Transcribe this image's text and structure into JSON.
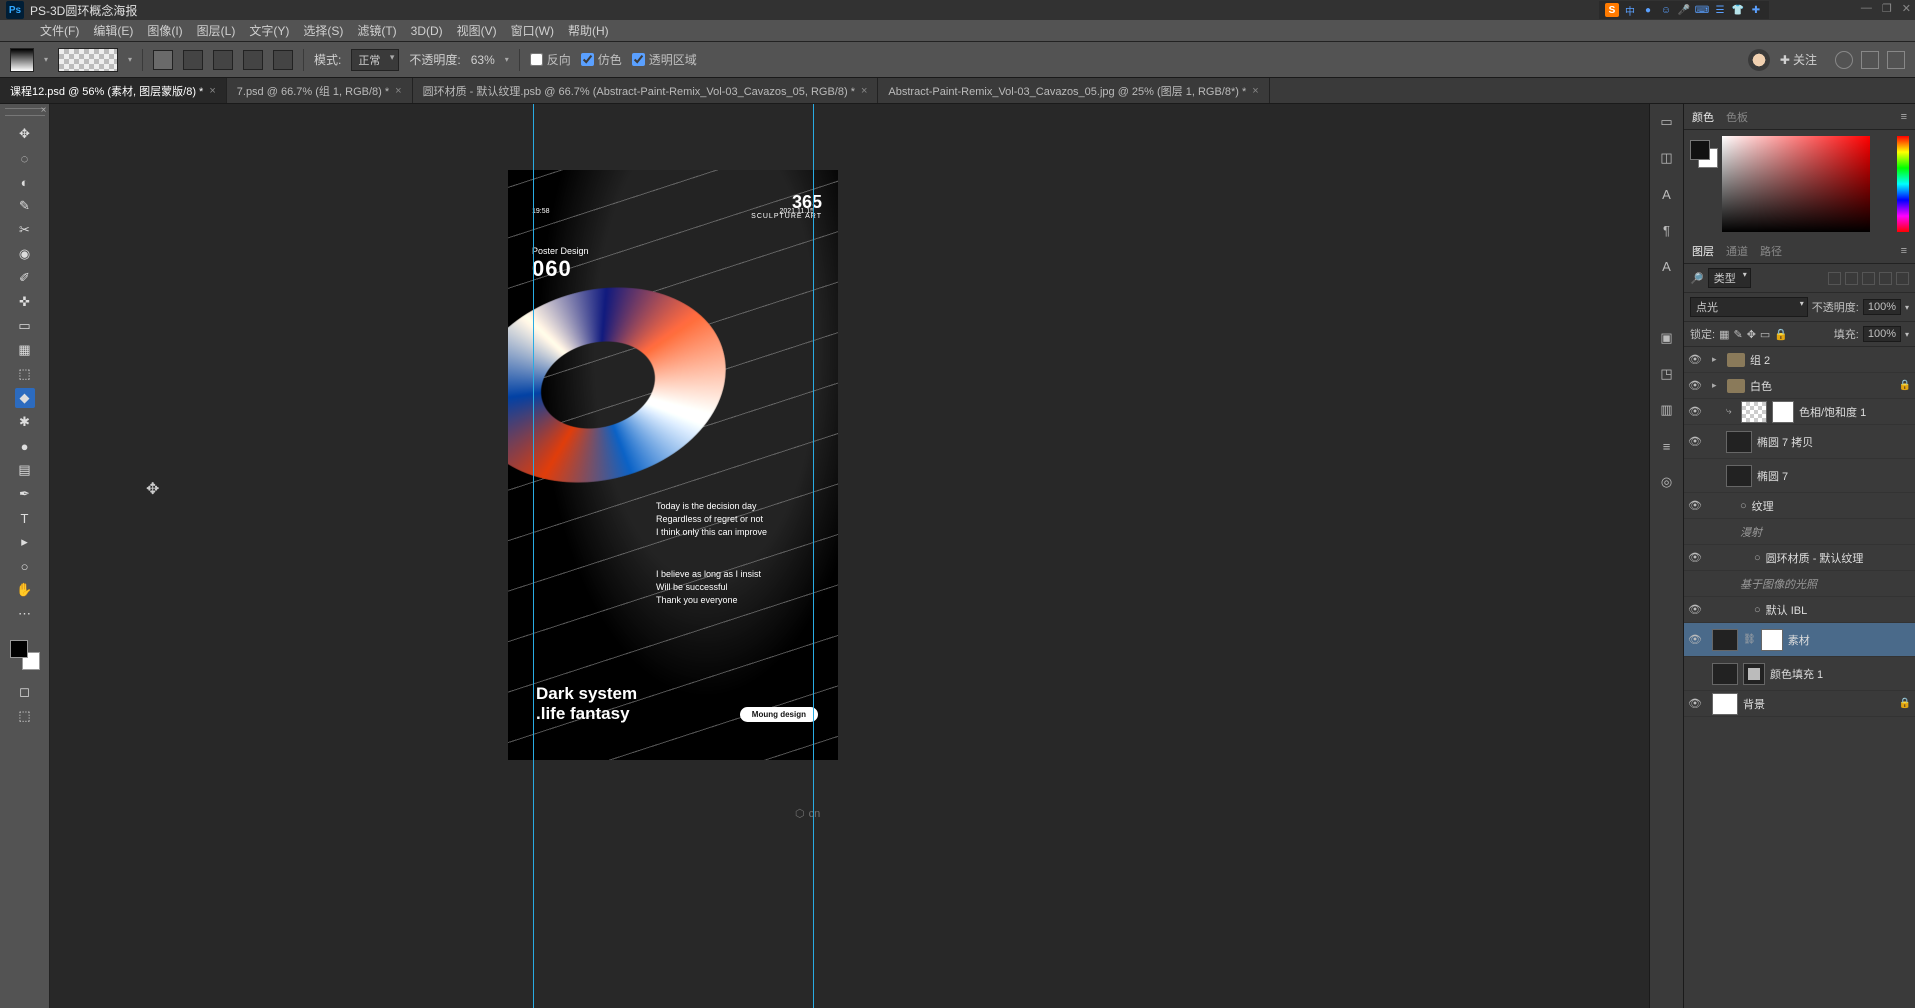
{
  "app": {
    "icon": "Ps",
    "title": "PS-3D圆环概念海报"
  },
  "win_ctrls": {
    "min": "—",
    "max": "❐",
    "close": "✕"
  },
  "indicators": [
    "中",
    "●",
    "☺",
    "🎤",
    "⌨",
    "☰",
    "👕",
    "✚"
  ],
  "menu": [
    "文件(F)",
    "编辑(E)",
    "图像(I)",
    "图层(L)",
    "文字(Y)",
    "选择(S)",
    "滤镜(T)",
    "3D(D)",
    "视图(V)",
    "窗口(W)",
    "帮助(H)"
  ],
  "opt": {
    "mode_label": "模式:",
    "mode_value": "正常",
    "opacity_label": "不透明度:",
    "opacity_value": "63%",
    "reverse": "反向",
    "dither": "仿色",
    "transparency": "透明区域",
    "follow": "关注"
  },
  "tabs": [
    {
      "label": "课程12.psd @ 56% (素材, 图层蒙版/8) *",
      "active": true
    },
    {
      "label": "7.psd @ 66.7% (组 1, RGB/8) *",
      "active": false
    },
    {
      "label": "圆环材质 - 默认纹理.psb @ 66.7% (Abstract-Paint-Remix_Vol-03_Cavazos_05, RGB/8) *",
      "active": false
    },
    {
      "label": "Abstract-Paint-Remix_Vol-03_Cavazos_05.jpg @ 25% (图层 1, RGB/8*) *",
      "active": false
    }
  ],
  "tools": [
    "✥",
    "◌",
    "◐",
    "✎",
    "✂",
    "◉",
    "✐",
    "✜",
    "▭",
    "▦",
    "⬚",
    "◆",
    "✱",
    "●",
    "▤",
    "✒",
    "T",
    "▸",
    "○",
    "✋",
    "🔍",
    "⋯"
  ],
  "mid_icons": [
    "▭",
    "◫",
    "A",
    "¶",
    "A",
    "▣",
    "◳",
    "▥",
    "≡",
    "◎"
  ],
  "color_panel": {
    "tabs": [
      "颜色",
      "色板"
    ]
  },
  "layers_panel": {
    "tabs": [
      "图层",
      "通道",
      "路径"
    ],
    "kind_label": "类型",
    "blend": "点光",
    "opacity_label": "不透明度:",
    "opacity_value": "100%",
    "lock_label": "锁定:",
    "fill_label": "填充:",
    "fill_value": "100%"
  },
  "layers": [
    {
      "eye": true,
      "indent": 0,
      "tw": "▸",
      "folder": true,
      "name": "组 2"
    },
    {
      "eye": true,
      "indent": 0,
      "tw": "▸",
      "folder": true,
      "name": "白色",
      "lock": true
    },
    {
      "eye": true,
      "indent": 1,
      "adjust": true,
      "name": "色相/饱和度 1"
    },
    {
      "eye": true,
      "indent": 1,
      "thumb": "img",
      "name": "椭圆 7 拷贝",
      "tall": true
    },
    {
      "eye": false,
      "indent": 1,
      "thumb": "img",
      "name": "椭圆 7",
      "tall": true
    },
    {
      "eye": true,
      "indent": 2,
      "sub": true,
      "name": "纹理"
    },
    {
      "eye": false,
      "indent": 2,
      "italic": true,
      "name": "漫射"
    },
    {
      "eye": true,
      "indent": 3,
      "sub": true,
      "name": "圆环材质 - 默认纹理"
    },
    {
      "eye": false,
      "indent": 2,
      "italic": true,
      "name": "基于图像的光照"
    },
    {
      "eye": true,
      "indent": 3,
      "sub": true,
      "name": "默认 IBL"
    },
    {
      "eye": true,
      "indent": 0,
      "thumb": "dark",
      "mask": true,
      "name": "素材",
      "selected": true,
      "tall": true
    },
    {
      "eye": false,
      "indent": 0,
      "thumb": "dark",
      "mask": "shape",
      "name": "颜色填充 1",
      "tall": true
    },
    {
      "eye": true,
      "indent": 0,
      "thumb": "white",
      "name": "背景",
      "lock": true
    }
  ],
  "poster": {
    "tl_small": "Poster Design",
    "tl_big": "060",
    "top_time": "19:58",
    "top_date": "2021.11.15",
    "tr_big": "365",
    "tr_small": "SCULPTURE ART",
    "p1_l1": "Today is the decision day",
    "p1_l2": "Regardless of regret or not",
    "p1_l3": "I think only this can improve",
    "p2_l1": "I believe as long as I insist",
    "p2_l2": "Will be successful",
    "p2_l3": "Thank you everyone",
    "b1": "Dark system",
    "b2": ".life fantasy",
    "badge": "Moung design"
  },
  "canvas_mark": "cn"
}
